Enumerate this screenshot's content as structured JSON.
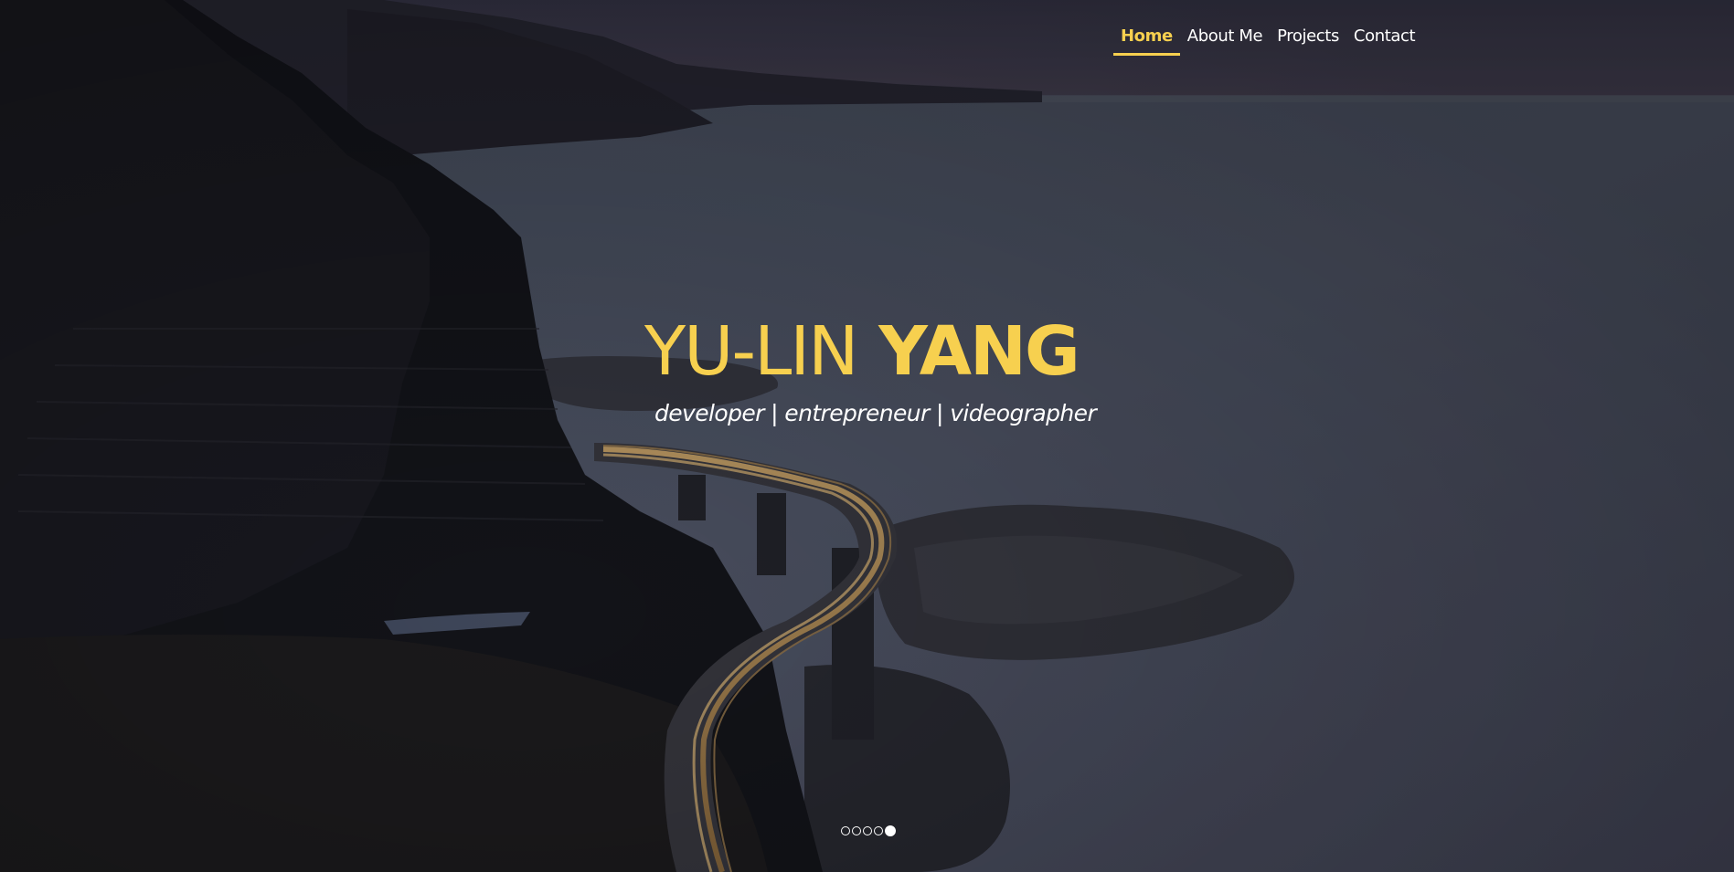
{
  "nav": {
    "items": [
      {
        "label": "Home",
        "active": true
      },
      {
        "label": "About Me",
        "active": false
      },
      {
        "label": "Projects",
        "active": false
      },
      {
        "label": "Contact",
        "active": false
      }
    ]
  },
  "hero": {
    "first_name": "YU-LIN",
    "last_name": "YANG",
    "tagline": "developer | entrepreneur | videographer",
    "background": "coastal-bridge-night-photo"
  },
  "carousel": {
    "slide_count": 5,
    "active_index": 4
  },
  "colors": {
    "accent": "#f7d04f",
    "text": "#ffffff",
    "sea": "#4a5063",
    "cliff": "#15161c"
  }
}
